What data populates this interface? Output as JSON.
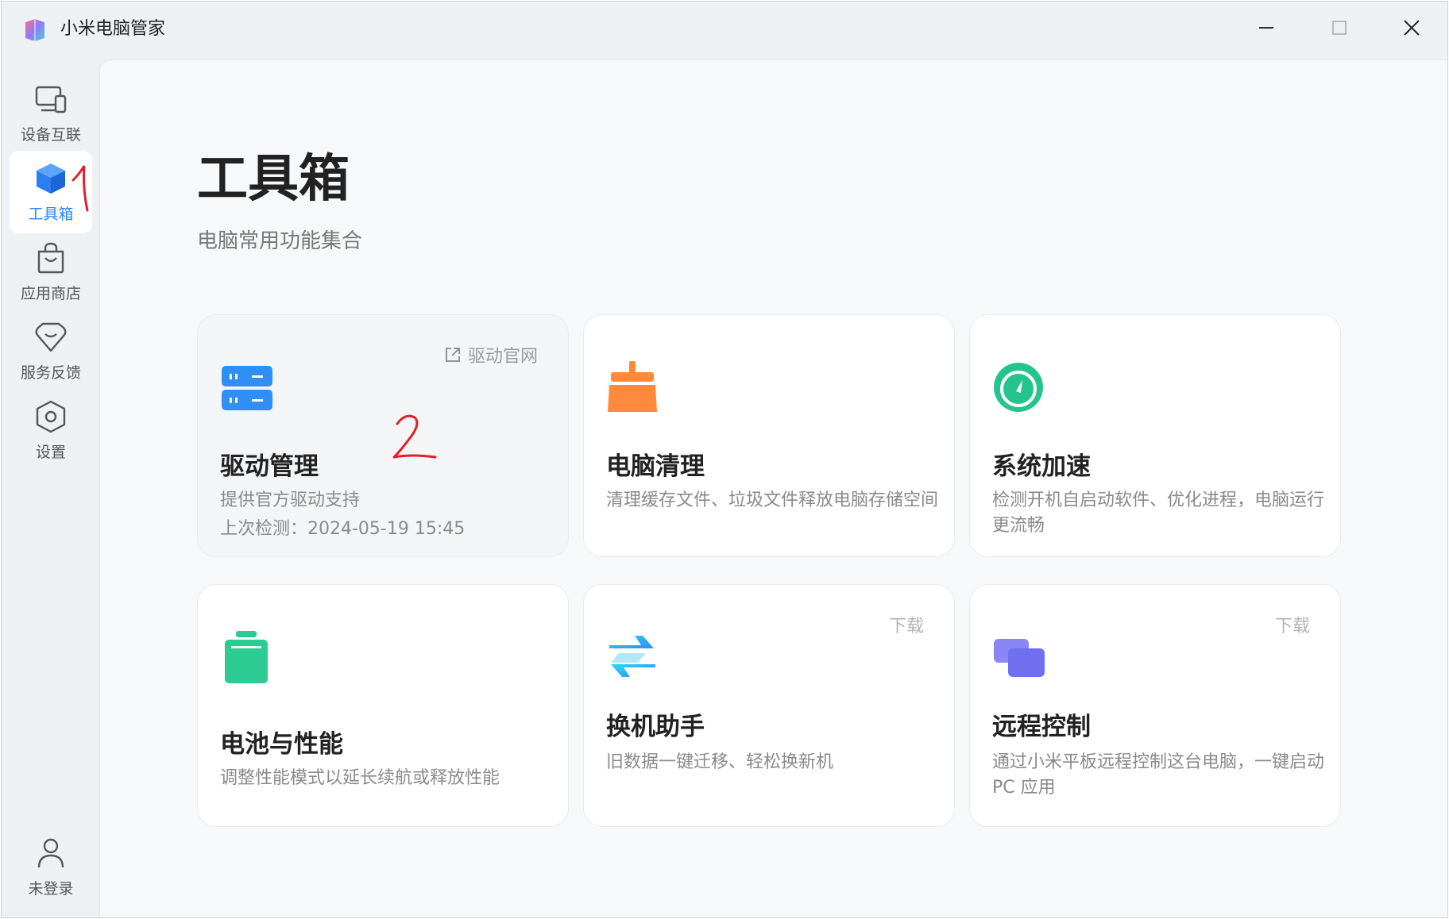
{
  "app": {
    "title": "小米电脑管家"
  },
  "sidebar": {
    "items": [
      {
        "label": "设备互联",
        "icon": "devices-icon",
        "active": false
      },
      {
        "label": "工具箱",
        "icon": "toolbox-cube-icon",
        "active": true
      },
      {
        "label": "应用商店",
        "icon": "shopping-bag-icon",
        "active": false
      },
      {
        "label": "服务反馈",
        "icon": "feedback-heart-icon",
        "active": false
      },
      {
        "label": "设置",
        "icon": "settings-hex-icon",
        "active": false
      }
    ],
    "account": {
      "label": "未登录",
      "icon": "user-icon"
    }
  },
  "page": {
    "title": "工具箱",
    "subtitle": "电脑常用功能集合"
  },
  "cards": [
    {
      "title": "驱动管理",
      "desc": "提供官方驱动支持",
      "desc2": "上次检测：2024-05-19 15:45",
      "corner": "驱动官网",
      "corner_icon": "external-link-icon",
      "icon": "driver-server-icon",
      "color": "#2f8ff7"
    },
    {
      "title": "电脑清理",
      "desc": "清理缓存文件、垃圾文件释放电脑存储空间",
      "icon": "broom-clean-icon",
      "color": "#ff8a3d"
    },
    {
      "title": "系统加速",
      "desc": "检测开机自启动软件、优化进程，电脑运行更流畅",
      "icon": "speedometer-icon",
      "color": "#25c48f"
    },
    {
      "title": "电池与性能",
      "desc": "调整性能模式以延长续航或释放性能",
      "icon": "battery-icon",
      "color": "#2ccb93"
    },
    {
      "title": "换机助手",
      "desc": "旧数据一键迁移、轻松换新机",
      "corner": "下载",
      "icon": "transfer-arrows-icon",
      "color": "#1fb3f2"
    },
    {
      "title": "远程控制",
      "desc": "通过小米平板远程控制这台电脑，一键启动 PC 应用",
      "corner": "下载",
      "icon": "remote-screens-icon",
      "color": "#7b7bf2"
    }
  ],
  "annotations": {
    "mark1": "1",
    "mark2": "2"
  }
}
